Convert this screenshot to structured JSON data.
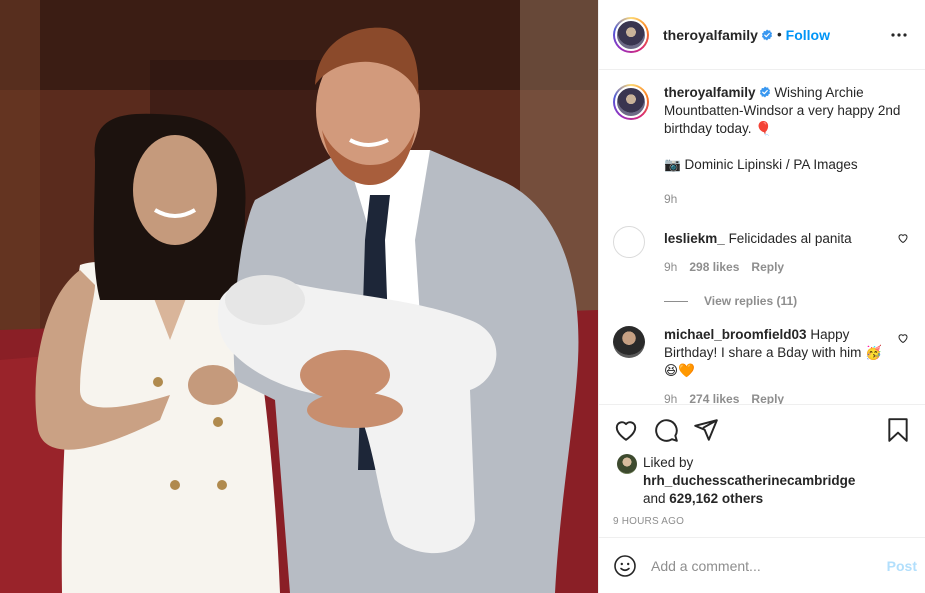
{
  "photo": {
    "alt": ""
  },
  "header": {
    "username": "theroyalfamily",
    "dot": "•",
    "follow_label": "Follow",
    "more_icon": "more-horizontal-icon",
    "verified_icon": "verified-badge-icon"
  },
  "caption": {
    "username": "theroyalfamily",
    "text": "Wishing Archie Mountbatten-Windsor a very happy 2nd birthday today. 🎈",
    "credit": "📷 Dominic Lipinski / PA Images",
    "time": "9h"
  },
  "comments": [
    {
      "username": "lesliekm_",
      "text": "Felicidades al panita",
      "time": "9h",
      "likes": "298 likes",
      "reply_label": "Reply",
      "view_replies": "View replies (11)"
    },
    {
      "username": "michael_broomfield03",
      "text": "Happy Birthday! I share a Bday with him 🥳😆🧡",
      "time": "9h",
      "likes": "274 likes",
      "reply_label": "Reply"
    }
  ],
  "actions": {
    "like_icon": "heart-icon",
    "comment_icon": "comment-icon",
    "share_icon": "share-icon",
    "save_icon": "bookmark-icon"
  },
  "likes": {
    "prefix": "Liked by",
    "user": "hrh_duchesscatherinecambridge",
    "and": "and",
    "others": "629,162 others"
  },
  "posted_ago": "9 HOURS AGO",
  "add_comment": {
    "placeholder": "Add a comment...",
    "post_label": "Post",
    "emoji_icon": "smiley-icon"
  },
  "colors": {
    "accent": "#0095f6",
    "post_disabled": "#b2dffc",
    "muted": "#8e8e8e",
    "text": "#262626"
  }
}
